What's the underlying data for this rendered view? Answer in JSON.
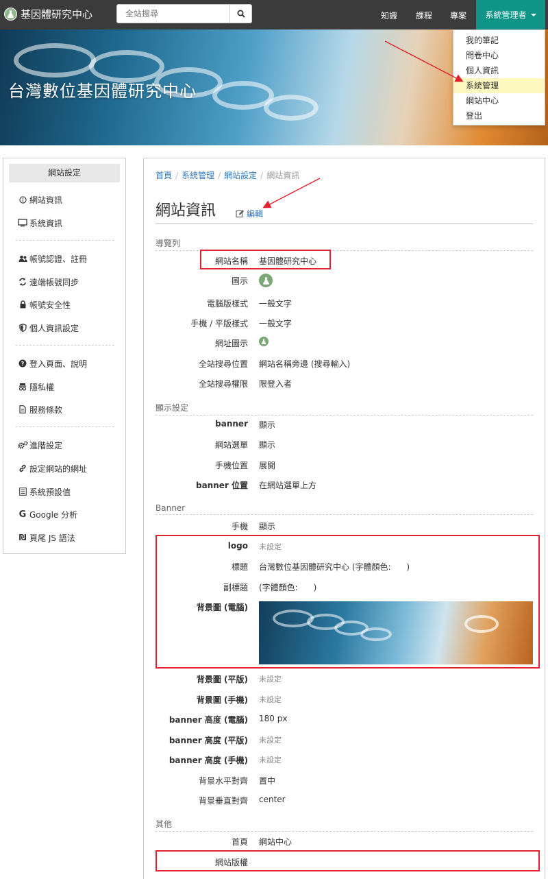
{
  "navbar": {
    "brand": "基因體研究中心",
    "search_placeholder": "全站搜尋",
    "links": [
      "知識",
      "課程",
      "專案"
    ],
    "admin_label": "系統管理者"
  },
  "banner": {
    "title": "台灣數位基因體研究中心"
  },
  "dropdown": {
    "items": [
      "我的筆記",
      "問卷中心",
      "個人資訊",
      "系統管理",
      "網站中心",
      "登出"
    ],
    "highlighted_index": 3,
    "highlight_color": "#fdf8c0"
  },
  "sidebar": {
    "heading": "網站設定",
    "groups": [
      [
        {
          "label": "網站資訊",
          "icon": "info-icon"
        },
        {
          "label": "系統資訊",
          "icon": "monitor-icon"
        }
      ],
      [
        {
          "label": "帳號認證、註冊",
          "icon": "users-icon"
        },
        {
          "label": "遠端帳號同步",
          "icon": "sync-icon"
        },
        {
          "label": "帳號安全性",
          "icon": "lock-icon"
        },
        {
          "label": "個人資訊設定",
          "icon": "shield-icon"
        }
      ],
      [
        {
          "label": "登入頁面、說明",
          "icon": "question-icon"
        },
        {
          "label": "隱私權",
          "icon": "privacy-icon"
        },
        {
          "label": "服務條款",
          "icon": "document-icon"
        }
      ],
      [
        {
          "label": "進階設定",
          "icon": "gears-icon"
        },
        {
          "label": "設定網站的網址",
          "icon": "link-icon"
        },
        {
          "label": "系統預設值",
          "icon": "list-icon"
        },
        {
          "label": "Google 分析",
          "icon": "google-icon"
        },
        {
          "label": "頁尾 JS 語法",
          "icon": "code-icon"
        }
      ]
    ]
  },
  "main": {
    "breadcrumb": [
      "首頁",
      "系統管理",
      "網站設定",
      "網站資訊"
    ],
    "title": "網站資訊",
    "edit_label": "編輯",
    "sections": [
      {
        "heading": "導覽列",
        "rows": [
          {
            "label": "網站名稱",
            "value": "基因體研究中心"
          },
          {
            "label": "圖示",
            "value": ""
          },
          {
            "label": "電腦版樣式",
            "value": "一般文字"
          },
          {
            "label": "手機 / 平版樣式",
            "value": "一般文字"
          },
          {
            "label": "網址圖示",
            "value": ""
          },
          {
            "label": "全站搜尋位置",
            "value": "網站名稱旁邊 (搜尋輸入)"
          },
          {
            "label": "全站搜尋權限",
            "value": "限登入者"
          }
        ]
      },
      {
        "heading": "顯示設定",
        "rows": [
          {
            "label": "banner",
            "value": "顯示"
          },
          {
            "label": "網站選單",
            "value": "顯示"
          },
          {
            "label": "手機位置",
            "value": "展開"
          },
          {
            "label": "banner 位置",
            "value": "在網站選單上方"
          }
        ]
      },
      {
        "heading": "Banner",
        "rows": [
          {
            "label": "手機",
            "value": "顯示"
          },
          {
            "label": "logo",
            "value": "未設定"
          },
          {
            "label": "標題",
            "value": "台灣數位基因體研究中心 (字體顏色:      )"
          },
          {
            "label": "副標題",
            "value": "(字體顏色:      )"
          },
          {
            "label": "背景圖 (電腦)",
            "value": ""
          },
          {
            "label": "背景圖 (平版)",
            "value": "未設定"
          },
          {
            "label": "背景圖 (手機)",
            "value": "未設定"
          },
          {
            "label": "banner 高度 (電腦)",
            "value": "180 px"
          },
          {
            "label": "banner 高度 (平版)",
            "value": "未設定"
          },
          {
            "label": "banner 高度 (手機)",
            "value": "未設定"
          },
          {
            "label": "背景水平對齊",
            "value": "置中"
          },
          {
            "label": "背景垂直對齊",
            "value": "center"
          }
        ]
      },
      {
        "heading": "其他",
        "rows": [
          {
            "label": "首頁",
            "value": "網站中心"
          },
          {
            "label": "網站版權",
            "value": ""
          }
        ]
      }
    ]
  },
  "colors": {
    "navbar": "#3b3b3b",
    "admin": "#0f9488",
    "link": "#2a75b8",
    "annotation": "#e0232e",
    "icon_green": "#7aa874"
  }
}
